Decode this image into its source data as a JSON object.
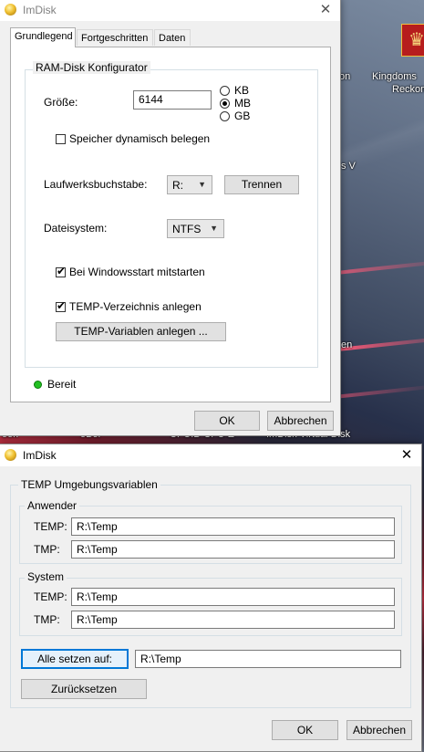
{
  "desktop": {
    "icon_label_line1": "Kingdoms",
    "icon_label_line2": "Reckon",
    "snippet_on": "on",
    "snippet_s_v": "s V",
    "snippet_en": "en",
    "snippet_bottom_1": "ook",
    "snippet_bottom_2": "oBoi",
    "snippet_bottom_3": "CPUID CPU-Z",
    "snippet_bottom_4": "ImDisk Virtual Disk"
  },
  "main_window": {
    "title": "ImDisk",
    "tabs": [
      "Grundlegend",
      "Fortgeschritten",
      "Daten"
    ],
    "active_tab": "Grundlegend",
    "group_title": "RAM-Disk Konfigurator",
    "size_label": "Größe:",
    "size_value": "6144",
    "units": [
      "KB",
      "MB",
      "GB"
    ],
    "selected_unit": "MB",
    "dynamic_label": "Speicher dynamisch belegen",
    "dynamic_checked": false,
    "drive_label": "Laufwerksbuchstabe:",
    "drive_value": "R:",
    "unmount_button": "Trennen",
    "fs_label": "Dateisystem:",
    "fs_value": "NTFS",
    "autostart_label": "Bei Windowsstart mitstarten",
    "autostart_checked": true,
    "temp_dir_label": "TEMP-Verzeichnis anlegen",
    "temp_dir_checked": true,
    "temp_vars_button": "TEMP-Variablen anlegen ...",
    "status_text": "Bereit",
    "status_color": "#22c022",
    "ok_button": "OK",
    "cancel_button": "Abbrechen"
  },
  "env_dialog": {
    "title": "ImDisk",
    "group_title": "TEMP Umgebungsvariablen",
    "user_group": "Anwender",
    "user_temp_label": "TEMP:",
    "user_temp_value": "R:\\Temp",
    "user_tmp_label": "TMP:",
    "user_tmp_value": "R:\\Temp",
    "system_group": "System",
    "system_temp_label": "TEMP:",
    "system_temp_value": "R:\\Temp",
    "system_tmp_label": "TMP:",
    "system_tmp_value": "R:\\Temp",
    "set_all_button": "Alle setzen auf:",
    "set_all_value": "R:\\Temp",
    "reset_button": "Zurücksetzen",
    "ok_button": "OK",
    "cancel_button": "Abbrechen"
  },
  "colors": {
    "focus_border": "#0078d7",
    "dialog_bg": "#f0f0f0"
  }
}
